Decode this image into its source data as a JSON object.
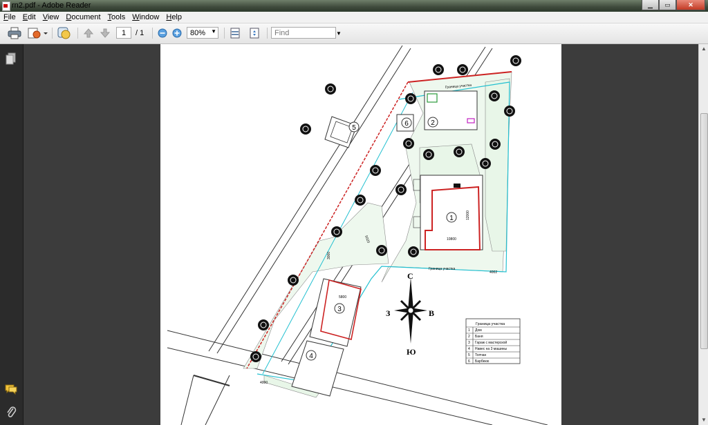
{
  "window": {
    "title": "rn2.pdf - Adobe Reader",
    "minimize": "▁",
    "maximize": "▭",
    "close": "✕"
  },
  "menu": [
    {
      "label": "File",
      "key": "F",
      "rest": "ile"
    },
    {
      "label": "Edit",
      "key": "E",
      "rest": "dit"
    },
    {
      "label": "View",
      "key": "V",
      "rest": "iew"
    },
    {
      "label": "Document",
      "key": "D",
      "rest": "ocument"
    },
    {
      "label": "Tools",
      "key": "T",
      "rest": "ools"
    },
    {
      "label": "Window",
      "key": "W",
      "rest": "indow"
    },
    {
      "label": "Help",
      "key": "H",
      "rest": "elp"
    }
  ],
  "toolbar": {
    "page_current": "1",
    "page_total": "/ 1",
    "zoom": "80%",
    "find_placeholder": "Find"
  },
  "plan": {
    "markers": [
      "1",
      "2",
      "3",
      "4",
      "5",
      "6"
    ],
    "compass": {
      "north": "С",
      "south": "Ю",
      "west": "З",
      "east": "В"
    },
    "boundary_label_top": "Граница участка",
    "boundary_label_bottom": "Граница участка",
    "dims": {
      "house_w": "10800",
      "house_h": "12000",
      "gap": "4000",
      "side": "4002",
      "g1": "3000",
      "g2": "5800",
      "g3": "5020",
      "g4": "4000"
    },
    "legend": {
      "title": "Граница участка",
      "rows": [
        {
          "num": "1",
          "text": "Дом"
        },
        {
          "num": "2",
          "text": "Баня"
        },
        {
          "num": "3",
          "text": "Гараж с мастерской"
        },
        {
          "num": "4",
          "text": "Навес на 3 машины"
        },
        {
          "num": "5",
          "text": "Топчан"
        },
        {
          "num": "6",
          "text": "Барбекю"
        }
      ]
    }
  },
  "colors": {
    "boundary": "#cc2222",
    "fence": "#22c0d0",
    "green": "#22a03a",
    "tree": "#111111"
  }
}
